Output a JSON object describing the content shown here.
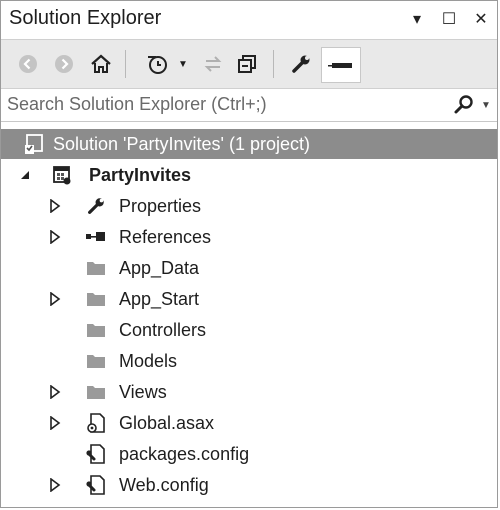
{
  "window": {
    "title": "Solution Explorer",
    "controls": {
      "dropdown": "▾",
      "maximize": "☐",
      "close": "✕"
    }
  },
  "search": {
    "placeholder": "Search Solution Explorer (Ctrl+;)"
  },
  "tree": {
    "solution": {
      "label": "Solution 'PartyInvites' (1 project)",
      "icon": "solution-icon"
    },
    "project": {
      "label": "PartyInvites",
      "icon": "project-icon"
    },
    "items": [
      {
        "label": "Properties",
        "icon": "wrench-icon",
        "expandable": true
      },
      {
        "label": "References",
        "icon": "references-icon",
        "expandable": true
      },
      {
        "label": "App_Data",
        "icon": "folder-icon",
        "expandable": false
      },
      {
        "label": "App_Start",
        "icon": "folder-icon",
        "expandable": true
      },
      {
        "label": "Controllers",
        "icon": "folder-icon",
        "expandable": false
      },
      {
        "label": "Models",
        "icon": "folder-icon",
        "expandable": false
      },
      {
        "label": "Views",
        "icon": "folder-icon",
        "expandable": true
      },
      {
        "label": "Global.asax",
        "icon": "global-asax-icon",
        "expandable": true
      },
      {
        "label": "packages.config",
        "icon": "config-file-icon",
        "expandable": false
      },
      {
        "label": "Web.config",
        "icon": "config-file-icon",
        "expandable": true
      }
    ]
  },
  "colors": {
    "selection": "#8c8c8c",
    "toolbar": "#e9e9e9",
    "text": "#1e1e1e"
  }
}
